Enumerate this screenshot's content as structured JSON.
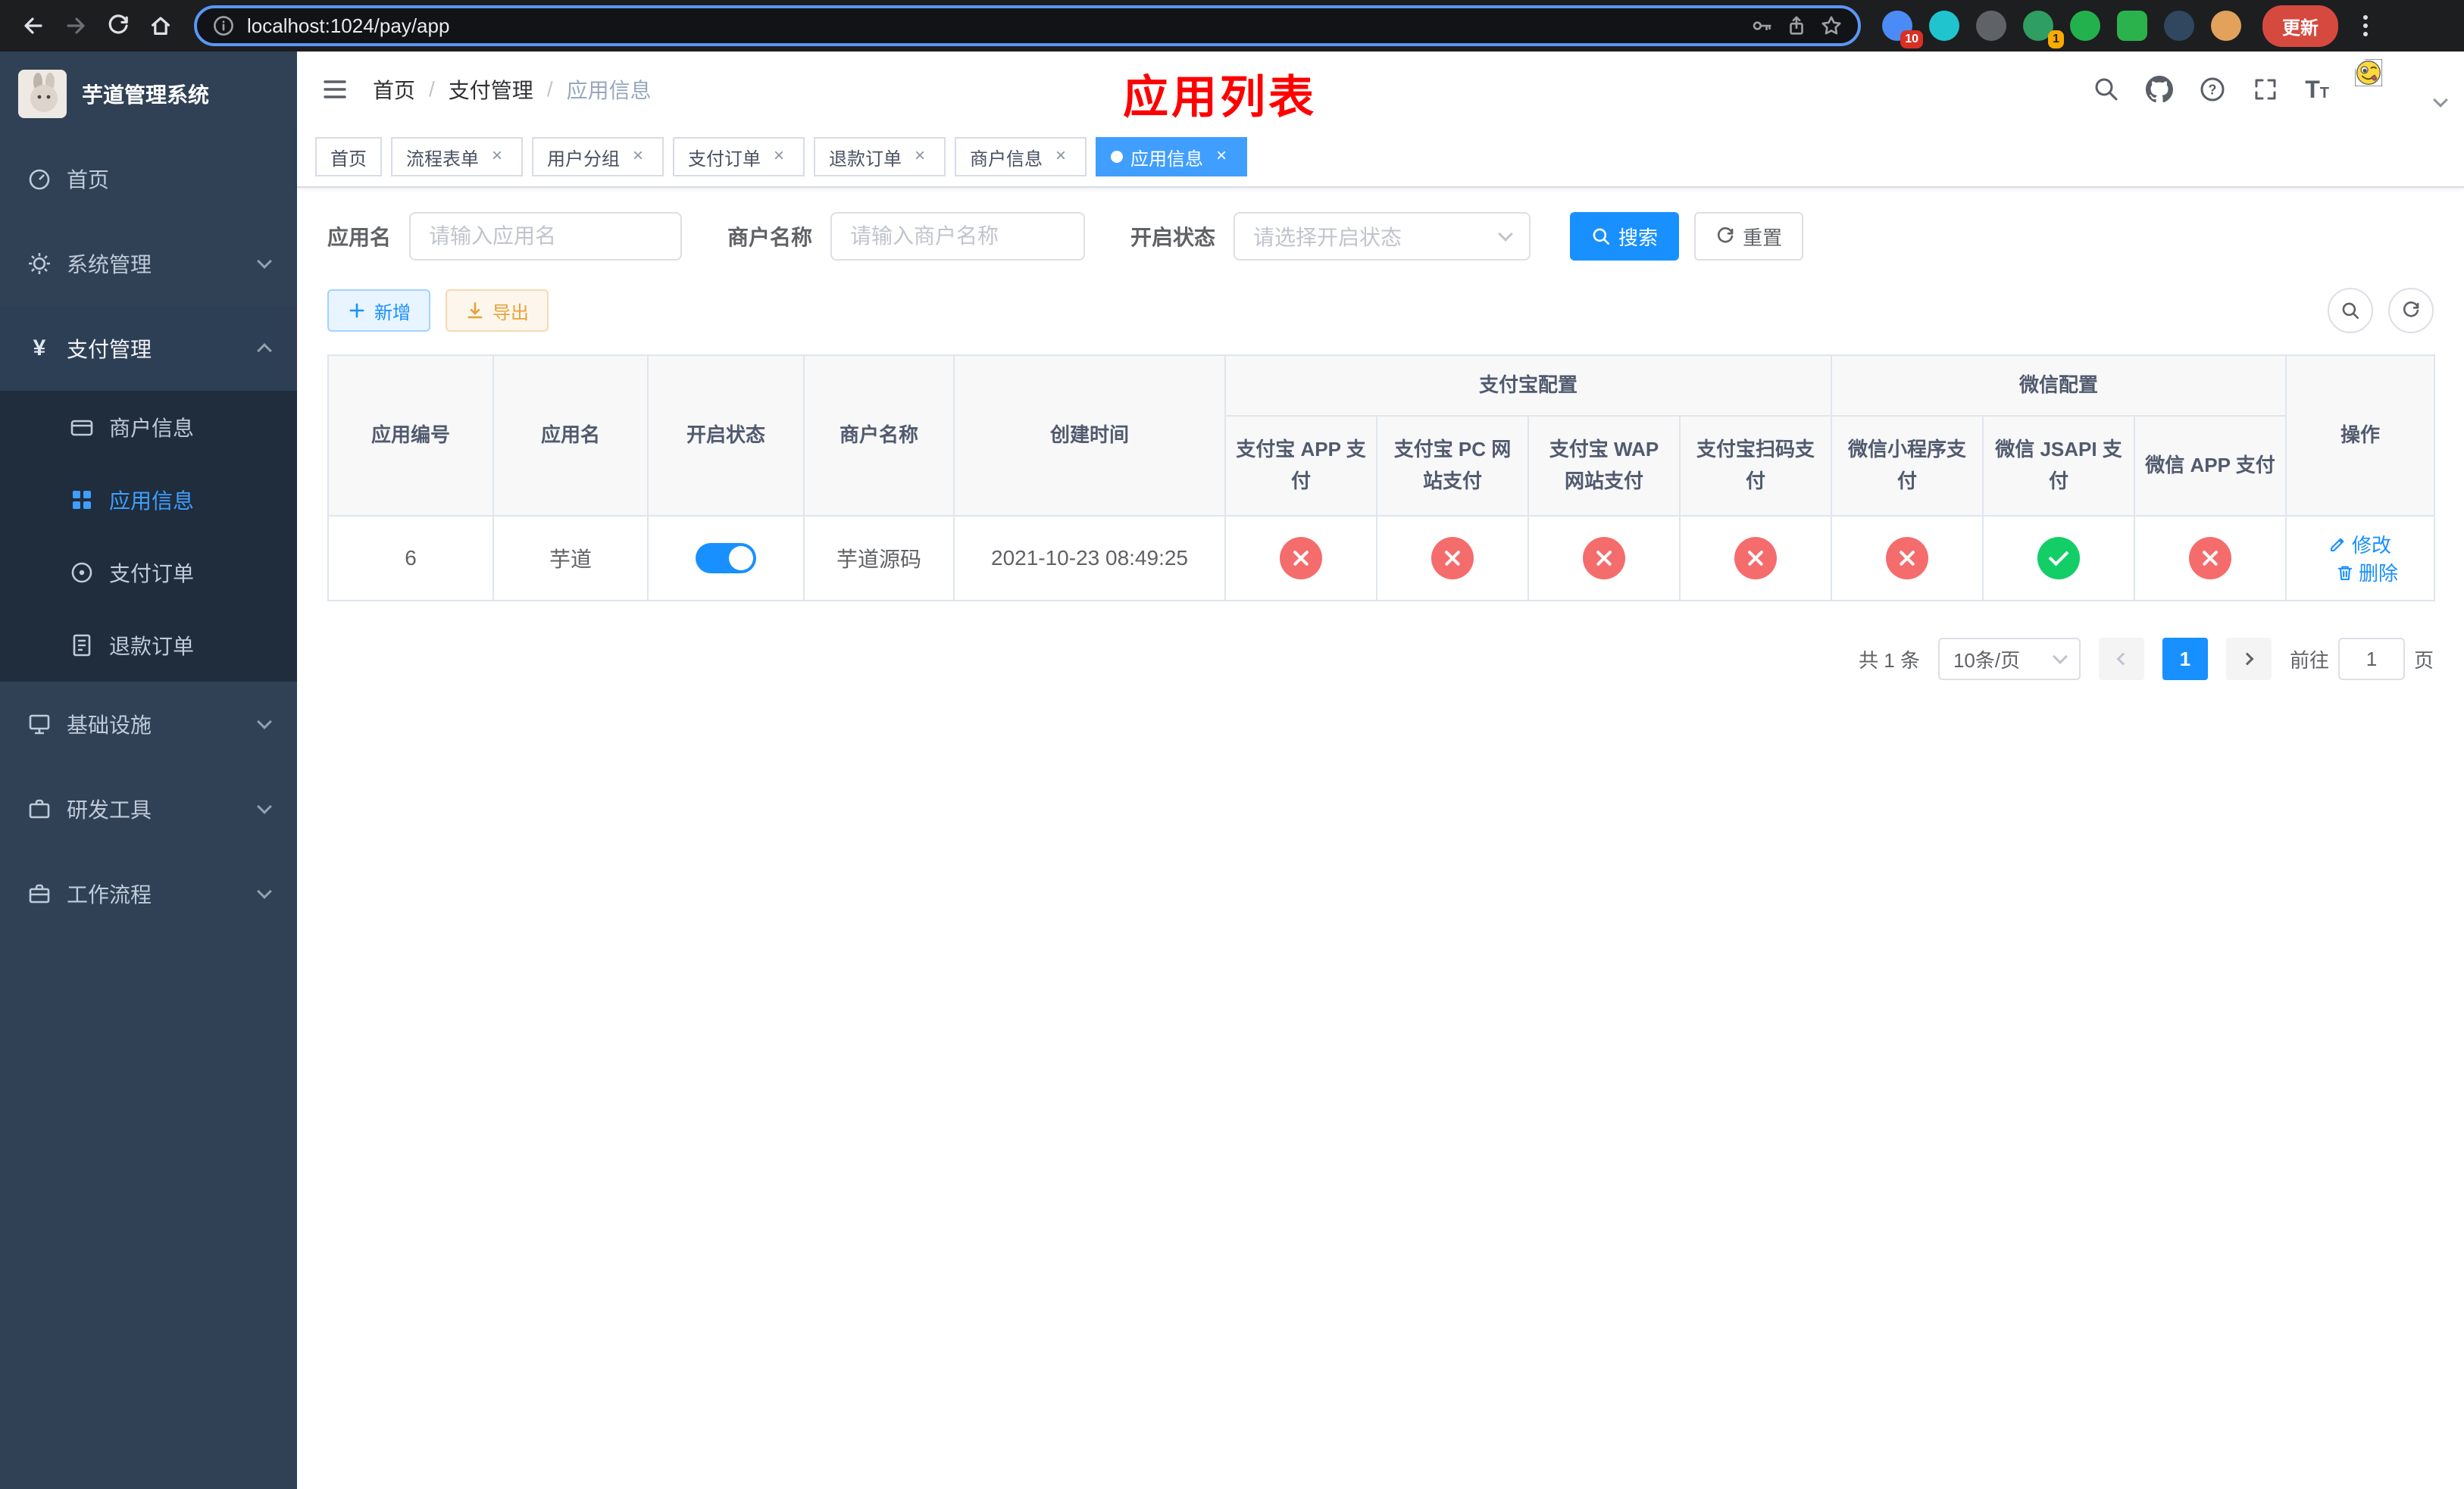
{
  "browser": {
    "url": "localhost:1024/pay/app",
    "update_label": "更新",
    "badge_blue": "10",
    "badge_green": "1"
  },
  "icons": {
    "yen": "¥",
    "close": "×",
    "question": "?",
    "font_big": "T",
    "font_small": "T"
  },
  "colors": {
    "primary_blue": "#1890ff",
    "link_blue": "#409eff",
    "success_green": "#13ce66",
    "danger_red": "#f56c6c",
    "warning_orange": "#e6a23c",
    "title_red": "#ff0000",
    "sidebar_bg": "#304156",
    "submenu_bg": "#1f2d3d"
  },
  "sidebar": {
    "logo_title": "芋道管理系统",
    "items": {
      "home": "首页",
      "system": "系统管理",
      "payment": "支付管理",
      "merchant_info": "商户信息",
      "app_info": "应用信息",
      "pay_order": "支付订单",
      "refund_order": "退款订单",
      "infrastructure": "基础设施",
      "dev_tools": "研发工具",
      "workflow": "工作流程"
    }
  },
  "header": {
    "breadcrumb": {
      "home": "首页",
      "section": "支付管理",
      "current": "应用信息",
      "separator": "/"
    },
    "page_title": "应用列表"
  },
  "tabs": [
    "首页",
    "流程表单",
    "用户分组",
    "支付订单",
    "退款订单",
    "商户信息",
    "应用信息"
  ],
  "filters": {
    "app_name_label": "应用名",
    "app_name_placeholder": "请输入应用名",
    "merchant_label": "商户名称",
    "merchant_placeholder": "请输入商户名称",
    "status_label": "开启状态",
    "status_placeholder": "请选择开启状态",
    "search_label": "搜索",
    "reset_label": "重置"
  },
  "toolbar": {
    "add_label": "新增",
    "export_label": "导出"
  },
  "table": {
    "alipay_group": "支付宝配置",
    "wechat_group": "微信配置",
    "columns": {
      "id": "应用编号",
      "name": "应用名",
      "status": "开启状态",
      "merchant": "商户名称",
      "created": "创建时间",
      "alipay_app": "支付宝 APP 支付",
      "alipay_pc": "支付宝 PC 网站支付",
      "alipay_wap": "支付宝 WAP 网站支付",
      "alipay_qr": "支付宝扫码支付",
      "wx_mini": "微信小程序支付",
      "wx_jsapi": "微信 JSAPI 支付",
      "wx_app": "微信 APP 支付",
      "ops": "操作"
    },
    "rows": [
      {
        "id": "6",
        "name": "芋道",
        "enabled": true,
        "merchant": "芋道源码",
        "created": "2021-10-23 08:49:25",
        "configs": [
          "no",
          "no",
          "no",
          "no",
          "no",
          "yes",
          "no"
        ],
        "edit_label": "修改",
        "delete_label": "删除"
      }
    ]
  },
  "pagination": {
    "total": "共 1 条",
    "page_size": "10条/页",
    "current_page": "1",
    "goto_prefix": "前往",
    "goto_suffix": "页",
    "goto_value": "1"
  }
}
